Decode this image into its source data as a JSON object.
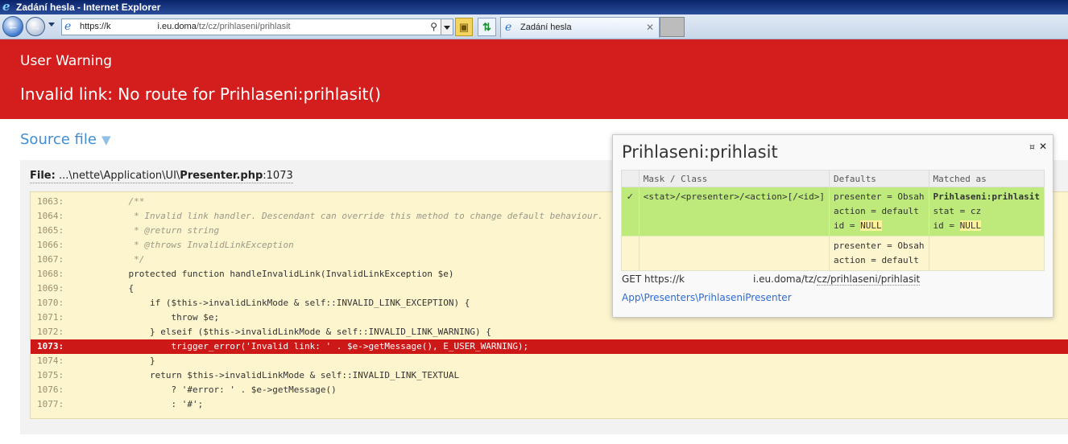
{
  "window": {
    "title": "Zadání hesla - Internet Explorer"
  },
  "toolbar": {
    "address_prefix": "https://k",
    "address_host": "i.eu.doma",
    "address_path": "/tz/cz/prihlaseni/prihlasit",
    "tab_label": "Zadání hesla"
  },
  "error": {
    "type": "User Warning",
    "message": "Invalid link: No route for Prihlaseni:prihlasit()"
  },
  "source": {
    "heading": "Source file",
    "file_label": "File:",
    "file_path": "...\\nette\\Application\\UI\\",
    "file_name": "Presenter.php",
    "file_line": ":1073",
    "lines": [
      {
        "num": "1063:",
        "code": "    /**"
      },
      {
        "num": "1064:",
        "code": "     * Invalid link handler. Descendant can override this method to change default behaviour."
      },
      {
        "num": "1065:",
        "code": "     * @return string"
      },
      {
        "num": "1066:",
        "code": "     * @throws InvalidLinkException"
      },
      {
        "num": "1067:",
        "code": "     */"
      },
      {
        "num": "1068:",
        "code": "    protected function handleInvalidLink(InvalidLinkException $e)"
      },
      {
        "num": "1069:",
        "code": "    {"
      },
      {
        "num": "1070:",
        "code": "        if ($this->invalidLinkMode & self::INVALID_LINK_EXCEPTION) {"
      },
      {
        "num": "1071:",
        "code": "            throw $e;"
      },
      {
        "num": "1072:",
        "code": "        } elseif ($this->invalidLinkMode & self::INVALID_LINK_WARNING) {"
      },
      {
        "num": "1073:",
        "code": "            trigger_error('Invalid link: ' . $e->getMessage(), E_USER_WARNING);"
      },
      {
        "num": "1074:",
        "code": "        }"
      },
      {
        "num": "1075:",
        "code": "        return $this->invalidLinkMode & self::INVALID_LINK_TEXTUAL"
      },
      {
        "num": "1076:",
        "code": "            ? '#error: ' . $e->getMessage()"
      },
      {
        "num": "1077:",
        "code": "            : '#';"
      }
    ]
  },
  "routing": {
    "title": "Prihlaseni:prihlasit",
    "pin_icon": "pin-icon",
    "close_icon": "close-icon",
    "headers": [
      "",
      "Mask / Class",
      "Defaults",
      "Matched as"
    ],
    "rows": [
      {
        "check": "✓",
        "mask": "<stat>/<presenter>/<action>[/<id>]",
        "defaults": [
          "presenter = Obsah",
          "action = default",
          "id = "
        ],
        "defaults_null": "NULL",
        "matched_title": "Prihlaseni:prihlasit",
        "matched": [
          "stat = cz",
          "id = "
        ],
        "matched_null": "NULL"
      },
      {
        "check": "",
        "mask": "",
        "defaults": [
          "presenter = Obsah",
          "action = default"
        ]
      }
    ],
    "get_prefix": "GET https://k",
    "get_host": "i.eu.doma/tz/",
    "get_rest": "cz/prihlaseni/prihlasit",
    "presenter_link": "App\\Presenters\\PrihlaseniPresenter"
  },
  "colors": {
    "error_red": "#d41e1e",
    "code_bg": "#fdf5ce",
    "match_green": "#bdea7b",
    "link_blue": "#3f8ed3"
  }
}
